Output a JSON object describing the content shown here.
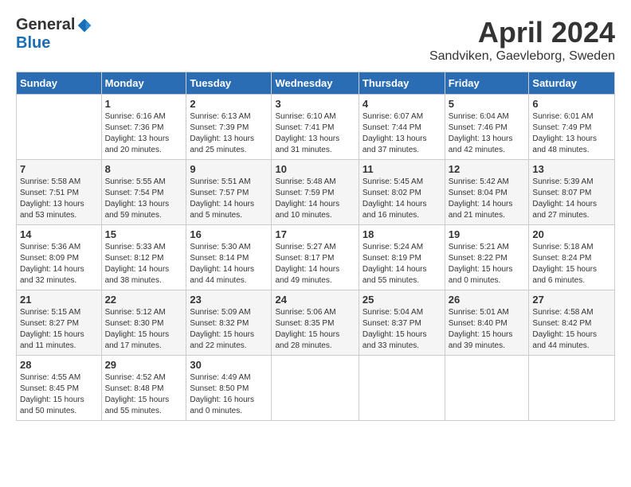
{
  "logo": {
    "general": "General",
    "blue": "Blue"
  },
  "title": "April 2024",
  "subtitle": "Sandviken, Gaevleborg, Sweden",
  "days_header": [
    "Sunday",
    "Monday",
    "Tuesday",
    "Wednesday",
    "Thursday",
    "Friday",
    "Saturday"
  ],
  "weeks": [
    [
      {
        "day": "",
        "info": ""
      },
      {
        "day": "1",
        "info": "Sunrise: 6:16 AM\nSunset: 7:36 PM\nDaylight: 13 hours\nand 20 minutes."
      },
      {
        "day": "2",
        "info": "Sunrise: 6:13 AM\nSunset: 7:39 PM\nDaylight: 13 hours\nand 25 minutes."
      },
      {
        "day": "3",
        "info": "Sunrise: 6:10 AM\nSunset: 7:41 PM\nDaylight: 13 hours\nand 31 minutes."
      },
      {
        "day": "4",
        "info": "Sunrise: 6:07 AM\nSunset: 7:44 PM\nDaylight: 13 hours\nand 37 minutes."
      },
      {
        "day": "5",
        "info": "Sunrise: 6:04 AM\nSunset: 7:46 PM\nDaylight: 13 hours\nand 42 minutes."
      },
      {
        "day": "6",
        "info": "Sunrise: 6:01 AM\nSunset: 7:49 PM\nDaylight: 13 hours\nand 48 minutes."
      }
    ],
    [
      {
        "day": "7",
        "info": "Sunrise: 5:58 AM\nSunset: 7:51 PM\nDaylight: 13 hours\nand 53 minutes."
      },
      {
        "day": "8",
        "info": "Sunrise: 5:55 AM\nSunset: 7:54 PM\nDaylight: 13 hours\nand 59 minutes."
      },
      {
        "day": "9",
        "info": "Sunrise: 5:51 AM\nSunset: 7:57 PM\nDaylight: 14 hours\nand 5 minutes."
      },
      {
        "day": "10",
        "info": "Sunrise: 5:48 AM\nSunset: 7:59 PM\nDaylight: 14 hours\nand 10 minutes."
      },
      {
        "day": "11",
        "info": "Sunrise: 5:45 AM\nSunset: 8:02 PM\nDaylight: 14 hours\nand 16 minutes."
      },
      {
        "day": "12",
        "info": "Sunrise: 5:42 AM\nSunset: 8:04 PM\nDaylight: 14 hours\nand 21 minutes."
      },
      {
        "day": "13",
        "info": "Sunrise: 5:39 AM\nSunset: 8:07 PM\nDaylight: 14 hours\nand 27 minutes."
      }
    ],
    [
      {
        "day": "14",
        "info": "Sunrise: 5:36 AM\nSunset: 8:09 PM\nDaylight: 14 hours\nand 32 minutes."
      },
      {
        "day": "15",
        "info": "Sunrise: 5:33 AM\nSunset: 8:12 PM\nDaylight: 14 hours\nand 38 minutes."
      },
      {
        "day": "16",
        "info": "Sunrise: 5:30 AM\nSunset: 8:14 PM\nDaylight: 14 hours\nand 44 minutes."
      },
      {
        "day": "17",
        "info": "Sunrise: 5:27 AM\nSunset: 8:17 PM\nDaylight: 14 hours\nand 49 minutes."
      },
      {
        "day": "18",
        "info": "Sunrise: 5:24 AM\nSunset: 8:19 PM\nDaylight: 14 hours\nand 55 minutes."
      },
      {
        "day": "19",
        "info": "Sunrise: 5:21 AM\nSunset: 8:22 PM\nDaylight: 15 hours\nand 0 minutes."
      },
      {
        "day": "20",
        "info": "Sunrise: 5:18 AM\nSunset: 8:24 PM\nDaylight: 15 hours\nand 6 minutes."
      }
    ],
    [
      {
        "day": "21",
        "info": "Sunrise: 5:15 AM\nSunset: 8:27 PM\nDaylight: 15 hours\nand 11 minutes."
      },
      {
        "day": "22",
        "info": "Sunrise: 5:12 AM\nSunset: 8:30 PM\nDaylight: 15 hours\nand 17 minutes."
      },
      {
        "day": "23",
        "info": "Sunrise: 5:09 AM\nSunset: 8:32 PM\nDaylight: 15 hours\nand 22 minutes."
      },
      {
        "day": "24",
        "info": "Sunrise: 5:06 AM\nSunset: 8:35 PM\nDaylight: 15 hours\nand 28 minutes."
      },
      {
        "day": "25",
        "info": "Sunrise: 5:04 AM\nSunset: 8:37 PM\nDaylight: 15 hours\nand 33 minutes."
      },
      {
        "day": "26",
        "info": "Sunrise: 5:01 AM\nSunset: 8:40 PM\nDaylight: 15 hours\nand 39 minutes."
      },
      {
        "day": "27",
        "info": "Sunrise: 4:58 AM\nSunset: 8:42 PM\nDaylight: 15 hours\nand 44 minutes."
      }
    ],
    [
      {
        "day": "28",
        "info": "Sunrise: 4:55 AM\nSunset: 8:45 PM\nDaylight: 15 hours\nand 50 minutes."
      },
      {
        "day": "29",
        "info": "Sunrise: 4:52 AM\nSunset: 8:48 PM\nDaylight: 15 hours\nand 55 minutes."
      },
      {
        "day": "30",
        "info": "Sunrise: 4:49 AM\nSunset: 8:50 PM\nDaylight: 16 hours\nand 0 minutes."
      },
      {
        "day": "",
        "info": ""
      },
      {
        "day": "",
        "info": ""
      },
      {
        "day": "",
        "info": ""
      },
      {
        "day": "",
        "info": ""
      }
    ]
  ]
}
